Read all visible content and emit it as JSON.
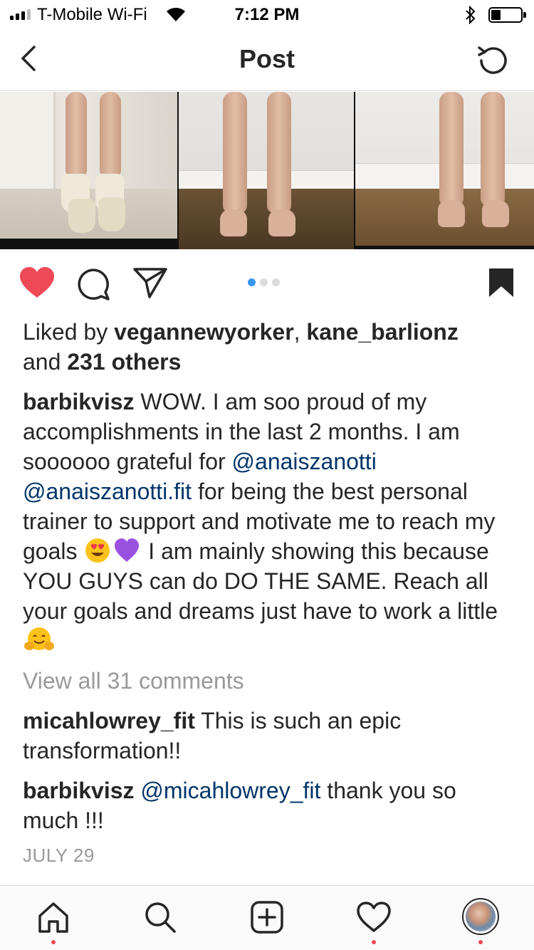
{
  "status_bar": {
    "carrier": "T-Mobile Wi-Fi",
    "time": "7:12 PM"
  },
  "header": {
    "title": "Post"
  },
  "carousel": {
    "count": 3,
    "active_index": 0
  },
  "likes": {
    "prefix": "Liked by ",
    "user1": "vegannewyorker",
    "sep": ", ",
    "user2": "kane_barlionz",
    "and": "and ",
    "others": "231 others"
  },
  "caption": {
    "username": "barbikvisz",
    "text1": " WOW. I am soo proud of my accomplishments in the last 2 months. I am soooooo grateful for ",
    "mention1": "@anaiszanotti",
    "space": " ",
    "mention2": "@anaiszanotti.fit",
    "text2": " for being the best personal trainer to support and motivate me to reach my goals ",
    "text3": " I am mainly showing this because YOU GUYS can do DO THE SAME. Reach all your goals and dreams just have to work a little ",
    "emojis": [
      "heart-eyes-emoji",
      "purple-heart-emoji",
      "hugging-face-emoji"
    ]
  },
  "view_all_comments": "View all 31 comments",
  "comments": [
    {
      "username": "micahlowrey_fit",
      "text": " This is such an epic transformation!!"
    },
    {
      "username": "barbikvisz",
      "mention": "@micahlowrey_fit",
      "text": " thank you so much !!!"
    }
  ],
  "date": "JULY 29",
  "colors": {
    "like": "#ed4956",
    "link": "#003569",
    "muted": "#999999",
    "accent": "#3897f0"
  },
  "tabs": [
    {
      "name": "home-icon",
      "has_dot": true
    },
    {
      "name": "search-icon",
      "has_dot": false
    },
    {
      "name": "new-post-icon",
      "has_dot": false
    },
    {
      "name": "activity-heart-icon",
      "has_dot": true
    },
    {
      "name": "profile-avatar",
      "has_dot": true
    }
  ]
}
